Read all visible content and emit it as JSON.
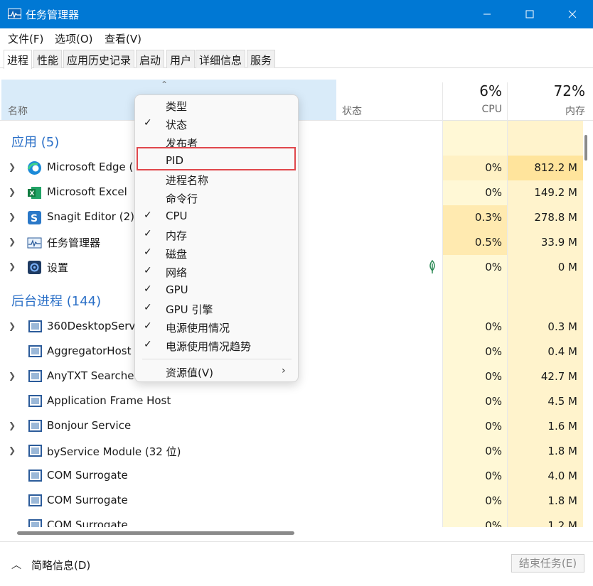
{
  "window": {
    "title": "任务管理器"
  },
  "menu": [
    "文件(F)",
    "选项(O)",
    "查看(V)"
  ],
  "tabs": [
    "进程",
    "性能",
    "应用历史记录",
    "启动",
    "用户",
    "详细信息",
    "服务"
  ],
  "header": {
    "name": "名称",
    "status": "状态",
    "cpu_pct": "6%",
    "cpu_label": "CPU",
    "mem_pct": "72%",
    "mem_label": "内存"
  },
  "groups": {
    "apps": "应用 (5)",
    "background": "后台进程 (144)"
  },
  "apps": [
    {
      "name": "Microsoft Edge (",
      "cpu": "0%",
      "mem": "812.2 M",
      "icon": "edge-icon"
    },
    {
      "name": "Microsoft Excel",
      "cpu": "0%",
      "mem": "149.2 M",
      "icon": "excel-icon"
    },
    {
      "name": "Snagit Editor (2)",
      "cpu": "0.3%",
      "mem": "278.8 M",
      "icon": "snagit-icon"
    },
    {
      "name": "任务管理器",
      "cpu": "0.5%",
      "mem": "33.9 M",
      "icon": "task-manager-icon"
    },
    {
      "name": "设置",
      "cpu": "0%",
      "mem": "0 M",
      "icon": "settings-icon"
    }
  ],
  "background": [
    {
      "name": "360DesktopServi",
      "cpu": "0%",
      "mem": "0.3 M",
      "expand": true
    },
    {
      "name": "AggregatorHost",
      "cpu": "0%",
      "mem": "0.4 M",
      "expand": false
    },
    {
      "name": "AnyTXT Searcher",
      "cpu": "0%",
      "mem": "42.7 M",
      "expand": true
    },
    {
      "name": "Application Frame Host",
      "cpu": "0%",
      "mem": "4.5 M",
      "expand": false
    },
    {
      "name": "Bonjour Service",
      "cpu": "0%",
      "mem": "1.6 M",
      "expand": true
    },
    {
      "name": "byService Module (32 位)",
      "cpu": "0%",
      "mem": "1.8 M",
      "expand": true
    },
    {
      "name": "COM Surrogate",
      "cpu": "0%",
      "mem": "4.0 M",
      "expand": false
    },
    {
      "name": "COM Surrogate",
      "cpu": "0%",
      "mem": "1.8 M",
      "expand": false
    },
    {
      "name": "COM Surrogate",
      "cpu": "0%",
      "mem": "1.2 M",
      "expand": false
    }
  ],
  "context_menu": [
    {
      "label": "类型",
      "checked": false
    },
    {
      "label": "状态",
      "checked": true
    },
    {
      "label": "发布者",
      "checked": false
    },
    {
      "label": "PID",
      "checked": false
    },
    {
      "label": "进程名称",
      "checked": false
    },
    {
      "label": "命令行",
      "checked": false
    },
    {
      "label": "CPU",
      "checked": true
    },
    {
      "label": "内存",
      "checked": true
    },
    {
      "label": "磁盘",
      "checked": true
    },
    {
      "label": "网络",
      "checked": true
    },
    {
      "label": "GPU",
      "checked": true
    },
    {
      "label": "GPU 引擎",
      "checked": true
    },
    {
      "label": "电源使用情况",
      "checked": true
    },
    {
      "label": "电源使用情况趋势",
      "checked": true
    }
  ],
  "context_submenu": {
    "label": "资源值(V)"
  },
  "footer": {
    "summary": "简略信息(D)",
    "end_task": "结束任务(E)"
  },
  "colors": {
    "titlebar": "#0078d4",
    "accent_text": "#2a6fc7",
    "cpu_column": "#fff8d6",
    "mem_column": "#fff1c4",
    "highlight_border": "#e0474c"
  }
}
